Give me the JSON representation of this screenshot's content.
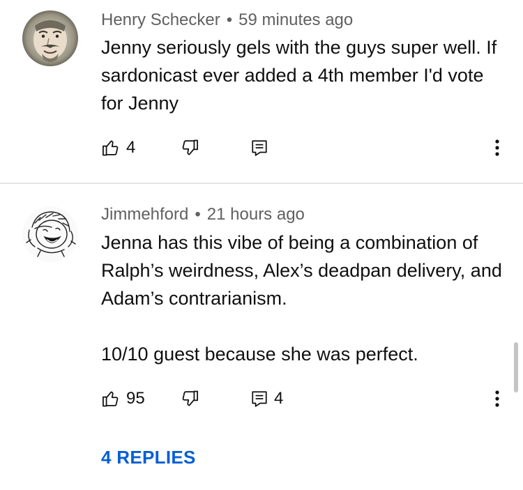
{
  "comments": [
    {
      "author": "Henry Schecker",
      "separator": "•",
      "time": "59 minutes ago",
      "paragraphs": [
        "Jenny seriously gels with the guys super well. If sardonicast ever added a 4th member I'd vote for Jenny"
      ],
      "likes": "4",
      "reply_count": "",
      "icons": {
        "like": "thumbs-up-icon",
        "dislike": "thumbs-down-icon",
        "reply": "reply-icon",
        "more": "more-vert-icon"
      }
    },
    {
      "author": "Jimmehford",
      "separator": "•",
      "time": "21 hours ago",
      "paragraphs": [
        "Jenna has this vibe of being a combination of Ralph’s weirdness, Alex’s deadpan delivery, and Adam’s contrarianism.",
        "10/10 guest because she was perfect."
      ],
      "likes": "95",
      "reply_count": "4",
      "replies_label": "4 REPLIES",
      "icons": {
        "like": "thumbs-up-icon",
        "dislike": "thumbs-down-icon",
        "reply": "reply-icon",
        "more": "more-vert-icon"
      }
    }
  ],
  "colors": {
    "text_primary": "#0f0f0f",
    "text_secondary": "#606060",
    "link_blue": "#065fd4",
    "divider": "#e5e5e5"
  }
}
